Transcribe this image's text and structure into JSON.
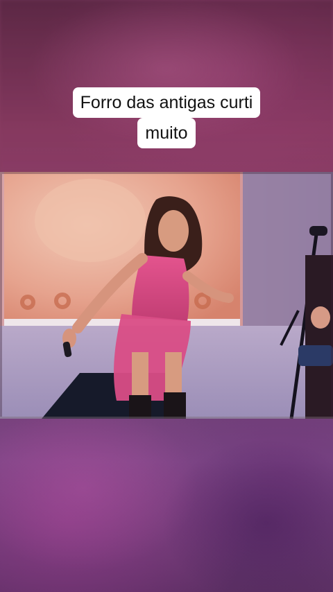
{
  "post": {
    "caption_line_1": "Forro das antigas curti",
    "caption_line_2": "muito"
  },
  "video": {
    "scene": "performer-on-stage-icon"
  }
}
